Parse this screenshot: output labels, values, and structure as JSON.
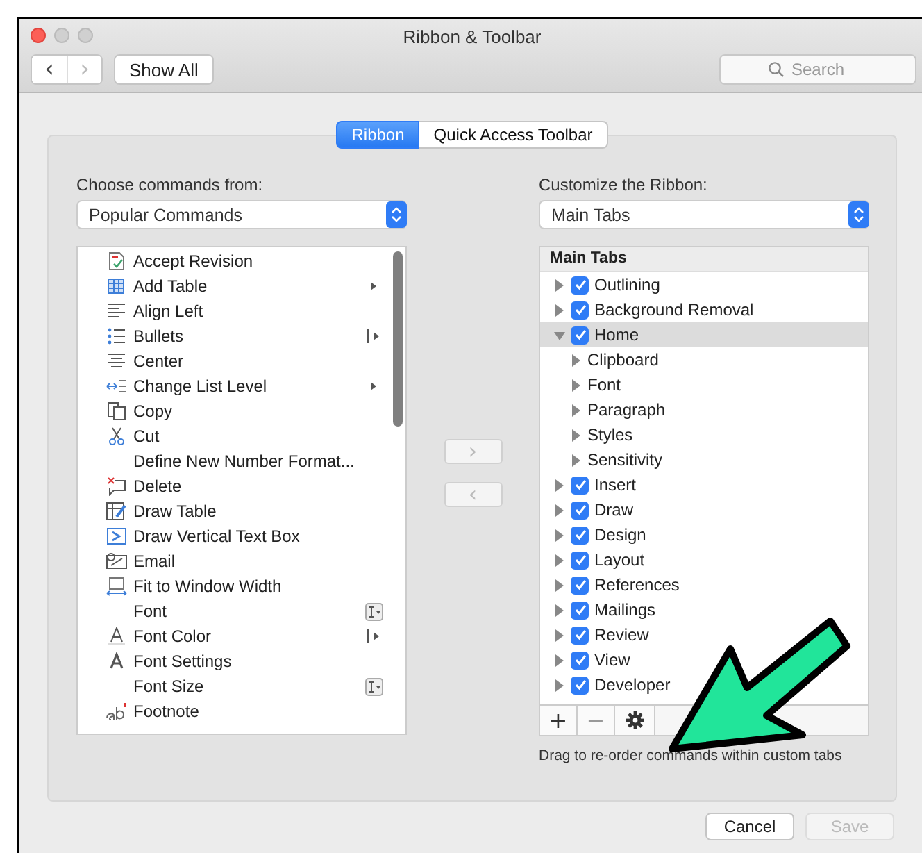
{
  "window": {
    "title": "Ribbon & Toolbar"
  },
  "toolbar": {
    "back": {
      "label": "‹",
      "disabled": false
    },
    "forward": {
      "label": "›",
      "disabled": true
    },
    "show_all": "Show All",
    "search": {
      "placeholder": "Search"
    }
  },
  "tabs": [
    {
      "label": "Ribbon",
      "selected": true
    },
    {
      "label": "Quick Access Toolbar",
      "selected": false
    }
  ],
  "left": {
    "label": "Choose commands from:",
    "dropdown": "Popular Commands",
    "commands": [
      {
        "name": "Accept Revision"
      },
      {
        "name": "Add Table"
      },
      {
        "name": "Align Left"
      },
      {
        "name": "Bullets"
      },
      {
        "name": "Center"
      },
      {
        "name": "Change List Level"
      },
      {
        "name": "Copy"
      },
      {
        "name": "Cut"
      },
      {
        "name": "Define New Number Format..."
      },
      {
        "name": "Delete"
      },
      {
        "name": "Draw Table"
      },
      {
        "name": "Draw Vertical Text Box"
      },
      {
        "name": "Email"
      },
      {
        "name": "Fit to Window Width"
      },
      {
        "name": "Font"
      },
      {
        "name": "Font Color"
      },
      {
        "name": "Font Settings"
      },
      {
        "name": "Font Size"
      },
      {
        "name": "Footnote"
      }
    ]
  },
  "move_buttons": [
    {
      "label": "›",
      "disabled": true
    },
    {
      "label": "‹",
      "disabled": true
    }
  ],
  "right": {
    "label": "Customize the Ribbon:",
    "dropdown": "Main Tabs",
    "tree_header": "Main Tabs",
    "tree": [
      {
        "name": "Outlining",
        "checked": true,
        "expanded": false,
        "selected": false
      },
      {
        "name": "Background Removal",
        "checked": true,
        "expanded": false,
        "selected": false
      },
      {
        "name": "Home",
        "checked": true,
        "expanded": true,
        "selected": true,
        "children": [
          {
            "name": "Clipboard",
            "expanded": false,
            "selected": false
          },
          {
            "name": "Font",
            "expanded": false,
            "selected": false
          },
          {
            "name": "Paragraph",
            "expanded": false,
            "selected": false
          },
          {
            "name": "Styles",
            "expanded": false,
            "selected": false
          },
          {
            "name": "Sensitivity",
            "expanded": false,
            "selected": false
          }
        ]
      },
      {
        "name": "Insert",
        "checked": true,
        "expanded": false,
        "selected": false
      },
      {
        "name": "Draw",
        "checked": true,
        "expanded": false,
        "selected": false
      },
      {
        "name": "Design",
        "checked": true,
        "expanded": false,
        "selected": false
      },
      {
        "name": "Layout",
        "checked": true,
        "expanded": false,
        "selected": false
      },
      {
        "name": "References",
        "checked": true,
        "expanded": false,
        "selected": false
      },
      {
        "name": "Mailings",
        "checked": true,
        "expanded": false,
        "selected": false
      },
      {
        "name": "Review",
        "checked": true,
        "expanded": false,
        "selected": false
      },
      {
        "name": "View",
        "checked": true,
        "expanded": false,
        "selected": false
      },
      {
        "name": "Developer",
        "checked": true,
        "expanded": false,
        "selected": false
      }
    ],
    "tree_buttons": [
      {
        "label": "+",
        "disabled": false
      },
      {
        "label": "−",
        "disabled": true
      }
    ],
    "hint": "Drag to re-order commands within custom tabs"
  },
  "footer": [
    {
      "label": "Cancel",
      "disabled": false
    },
    {
      "label": "Save",
      "disabled": true
    }
  ]
}
